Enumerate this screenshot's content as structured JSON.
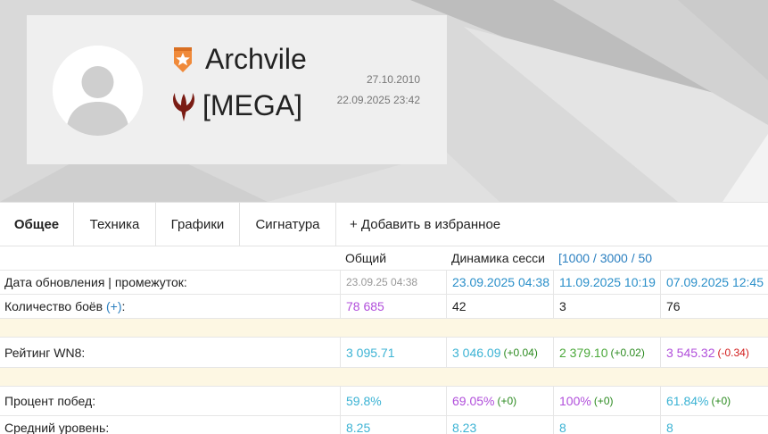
{
  "profile": {
    "player_name": "Archvile",
    "clan_tag": "[MEGA]",
    "registration_date": "27.10.2010",
    "last_battle": "22.09.2025 23:42"
  },
  "tabs": [
    {
      "label": "Общее",
      "active": true
    },
    {
      "label": "Техника"
    },
    {
      "label": "Графики"
    },
    {
      "label": "Сигнатура"
    }
  ],
  "add_favorite": "+ Добавить в избранное",
  "table": {
    "header": {
      "overall": "Общий",
      "session_dynamics": "Динамика сесси",
      "ranges": "[1000 / 3000 / 50"
    },
    "updated": {
      "label": "Дата обновления | промежуток:",
      "values": [
        "23.09.25 04:38",
        "23.09.2025 04:38",
        "11.09.2025 10:19",
        "07.09.2025 12:45"
      ]
    },
    "battles": {
      "label": "Количество боёв ",
      "link": "(+)",
      "label_suffix": ":",
      "values": [
        "78 685",
        "42",
        "3",
        "76"
      ]
    },
    "wn8": {
      "label": "Рейтинг WN8:",
      "values": [
        "3 095.71",
        "3 046.09",
        "2 379.10",
        "3 545.32"
      ],
      "deltas": [
        "",
        "(+0.04)",
        "(+0.02)",
        "(-0.34)"
      ]
    },
    "winrate": {
      "label": "Процент побед:",
      "values": [
        "59.8%",
        "69.05%",
        "100%",
        "61.84%"
      ],
      "deltas": [
        "",
        "(+0)",
        "(+0)",
        "(+0)"
      ]
    },
    "avg_tier": {
      "label": "Средний уровень:",
      "values": [
        "8.25",
        "8.23",
        "8",
        "8"
      ]
    }
  },
  "colors": {
    "blue": "#2a8fc9",
    "teal": "#3cb3d4",
    "green": "#4ba83a",
    "purple": "#b14fdb",
    "spacer": "#fdf7e3",
    "badge": "#f08a3a",
    "clan_logo": "#7a1c14"
  },
  "icons": {
    "badge": "star-shield-icon",
    "clan": "quake-logo-icon",
    "avatar": "user-placeholder-icon"
  }
}
